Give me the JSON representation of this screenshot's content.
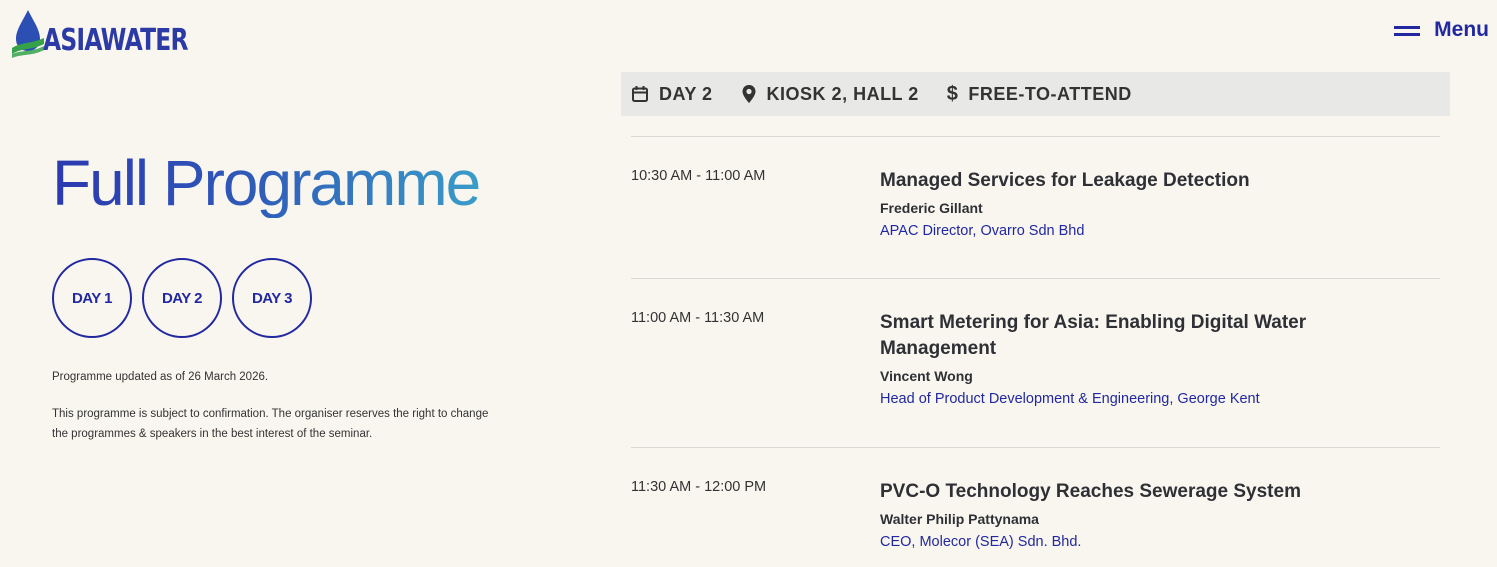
{
  "header": {
    "logo_text": "ASIAWATER",
    "menu_label": "Menu"
  },
  "programme": {
    "title": "Full Programme",
    "days": [
      "DAY 1",
      "DAY 2",
      "DAY 3"
    ],
    "updated_note": "Programme updated as of 26 March 2026.",
    "disclaimer": "This programme is subject to confirmation. The organiser reserves the right to change the programmes & speakers in the best interest of the seminar."
  },
  "info_bar": {
    "day": "DAY 2",
    "location": "KIOSK 2, HALL 2",
    "price": "FREE-TO-ATTEND"
  },
  "sessions": [
    {
      "time": "10:30 AM - 11:00 AM",
      "topic": "Managed Services for Leakage Detection",
      "speaker": "Frederic Gillant",
      "role": "APAC Director, Ovarro Sdn Bhd"
    },
    {
      "time": "11:00 AM - 11:30 AM",
      "topic": "Smart Metering for Asia: Enabling Digital Water Management",
      "speaker": "Vincent Wong",
      "role": "Head of Product Development & Engineering, George Kent"
    },
    {
      "time": "11:30 AM - 12:00 PM",
      "topic": "PVC-O Technology Reaches Sewerage System",
      "speaker": "Walter Philip Pattynama",
      "role": "CEO, Molecor (SEA) Sdn. Bhd."
    }
  ],
  "colors": {
    "background": "#f8f6ef",
    "accent": "#2228a0",
    "info_bar": "#e8e8e6"
  }
}
